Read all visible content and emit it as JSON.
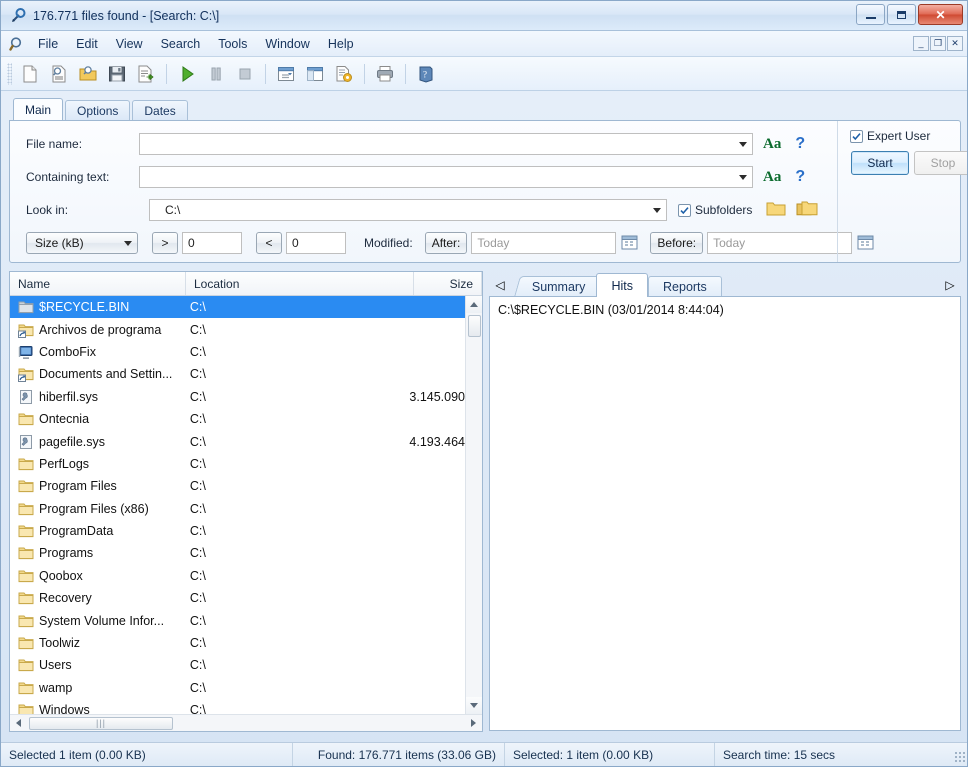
{
  "window": {
    "title": "176.771 files found - [Search: C:\\]",
    "app_icon": "magnifier-icon",
    "minimize_label": "",
    "maximize_label": "",
    "close_label": "✕"
  },
  "mdi_buttons": {
    "minimize": "_",
    "restore": "❐",
    "close": "✕"
  },
  "menu": {
    "search_icon": "search-icon",
    "items": [
      {
        "label": "File"
      },
      {
        "label": "Edit"
      },
      {
        "label": "View"
      },
      {
        "label": "Search"
      },
      {
        "label": "Tools"
      },
      {
        "label": "Window"
      },
      {
        "label": "Help"
      }
    ]
  },
  "toolbar": {
    "buttons": [
      {
        "name": "new-search-icon",
        "title": "New"
      },
      {
        "name": "duplicate-search-icon",
        "title": "New search"
      },
      {
        "name": "open-folder-icon",
        "title": "Open"
      },
      {
        "name": "save-icon",
        "title": "Save"
      },
      {
        "name": "export-icon",
        "title": "Export"
      },
      {
        "name": "start-icon",
        "title": "Start"
      },
      {
        "name": "pause-icon",
        "title": "Pause"
      },
      {
        "name": "stop-icon",
        "title": "Stop"
      },
      {
        "name": "window-layout-icon",
        "title": "Layout"
      },
      {
        "name": "split-view-icon",
        "title": "Split view"
      },
      {
        "name": "settings-view-icon",
        "title": "Options"
      },
      {
        "name": "print-icon",
        "title": "Print"
      },
      {
        "name": "help-icon",
        "title": "Help"
      }
    ]
  },
  "search_panel": {
    "tabs": [
      {
        "label": "Main",
        "active": true
      },
      {
        "label": "Options",
        "active": false
      },
      {
        "label": "Dates",
        "active": false
      }
    ],
    "file_name": {
      "label": "File name:",
      "value": "",
      "placeholder": ""
    },
    "containing_text": {
      "label": "Containing text:",
      "value": "",
      "placeholder": ""
    },
    "look_in": {
      "label": "Look in:",
      "value": "C:\\"
    },
    "case_icon_label": "Aa",
    "help_icon_label": "?",
    "subfolders": {
      "label": "Subfolders",
      "checked": true
    },
    "size_filter": {
      "unit": "Size (kB)",
      "greater_op": ">",
      "greater_value": "0",
      "less_op": "<",
      "less_value": "0"
    },
    "modified": {
      "label": "Modified:",
      "after_label": "After:",
      "after_value": "Today",
      "before_label": "Before:",
      "before_value": "Today"
    },
    "expert_user": {
      "label": "Expert User",
      "checked": true
    },
    "start_button": "Start",
    "stop_button": "Stop",
    "browse_folder_icon": "folder-icon",
    "browse_folders_icon": "folders-icon"
  },
  "results": {
    "columns": [
      {
        "label": "Name"
      },
      {
        "label": "Location"
      },
      {
        "label": "Size"
      }
    ],
    "rows": [
      {
        "name": "$RECYCLE.BIN",
        "location": "C:\\",
        "size": "",
        "icon": "recycle-folder-icon",
        "selected": true
      },
      {
        "name": "Archivos de programa",
        "location": "C:\\",
        "size": "",
        "icon": "shortcut-folder-icon",
        "selected": false
      },
      {
        "name": "ComboFix",
        "location": "C:\\",
        "size": "",
        "icon": "application-icon",
        "selected": false
      },
      {
        "name": "Documents and Settin...",
        "location": "C:\\",
        "size": "",
        "icon": "shortcut-folder-icon",
        "selected": false
      },
      {
        "name": "hiberfil.sys",
        "location": "C:\\",
        "size": "3.145.090",
        "icon": "system-file-icon",
        "selected": false
      },
      {
        "name": "Ontecnia",
        "location": "C:\\",
        "size": "",
        "icon": "folder-icon",
        "selected": false
      },
      {
        "name": "pagefile.sys",
        "location": "C:\\",
        "size": "4.193.464",
        "icon": "system-file-icon",
        "selected": false
      },
      {
        "name": "PerfLogs",
        "location": "C:\\",
        "size": "",
        "icon": "folder-icon",
        "selected": false
      },
      {
        "name": "Program Files",
        "location": "C:\\",
        "size": "",
        "icon": "folder-icon",
        "selected": false
      },
      {
        "name": "Program Files (x86)",
        "location": "C:\\",
        "size": "",
        "icon": "folder-icon",
        "selected": false
      },
      {
        "name": "ProgramData",
        "location": "C:\\",
        "size": "",
        "icon": "folder-icon",
        "selected": false
      },
      {
        "name": "Programs",
        "location": "C:\\",
        "size": "",
        "icon": "folder-icon",
        "selected": false
      },
      {
        "name": "Qoobox",
        "location": "C:\\",
        "size": "",
        "icon": "folder-icon",
        "selected": false
      },
      {
        "name": "Recovery",
        "location": "C:\\",
        "size": "",
        "icon": "folder-icon",
        "selected": false
      },
      {
        "name": "System Volume Infor...",
        "location": "C:\\",
        "size": "",
        "icon": "folder-icon",
        "selected": false
      },
      {
        "name": "Toolwiz",
        "location": "C:\\",
        "size": "",
        "icon": "folder-icon",
        "selected": false
      },
      {
        "name": "Users",
        "location": "C:\\",
        "size": "",
        "icon": "folder-icon",
        "selected": false
      },
      {
        "name": "wamp",
        "location": "C:\\",
        "size": "",
        "icon": "folder-icon",
        "selected": false
      },
      {
        "name": "Windows",
        "location": "C:\\",
        "size": "",
        "icon": "folder-icon",
        "selected": false
      }
    ]
  },
  "detail_panel": {
    "nav_left": "◁",
    "nav_right": "▷",
    "tabs": [
      {
        "label": "Summary",
        "active": false
      },
      {
        "label": "Hits",
        "active": true
      },
      {
        "label": "Reports",
        "active": false
      }
    ],
    "hit_line": "C:\\$RECYCLE.BIN   (03/01/2014 8:44:04)"
  },
  "statusbar": {
    "selected_left": "Selected 1 item (0.00 KB)",
    "found": "Found: 176.771 items (33.06 GB)",
    "selected_right": "Selected: 1 item (0.00 KB)",
    "search_time": "Search time: 15 secs"
  },
  "colors": {
    "selection_blue": "#2a8bf2",
    "accent_green": "#0b6b2e",
    "accent_blue": "#2a6fc9",
    "close_red": "#cf4a32"
  }
}
